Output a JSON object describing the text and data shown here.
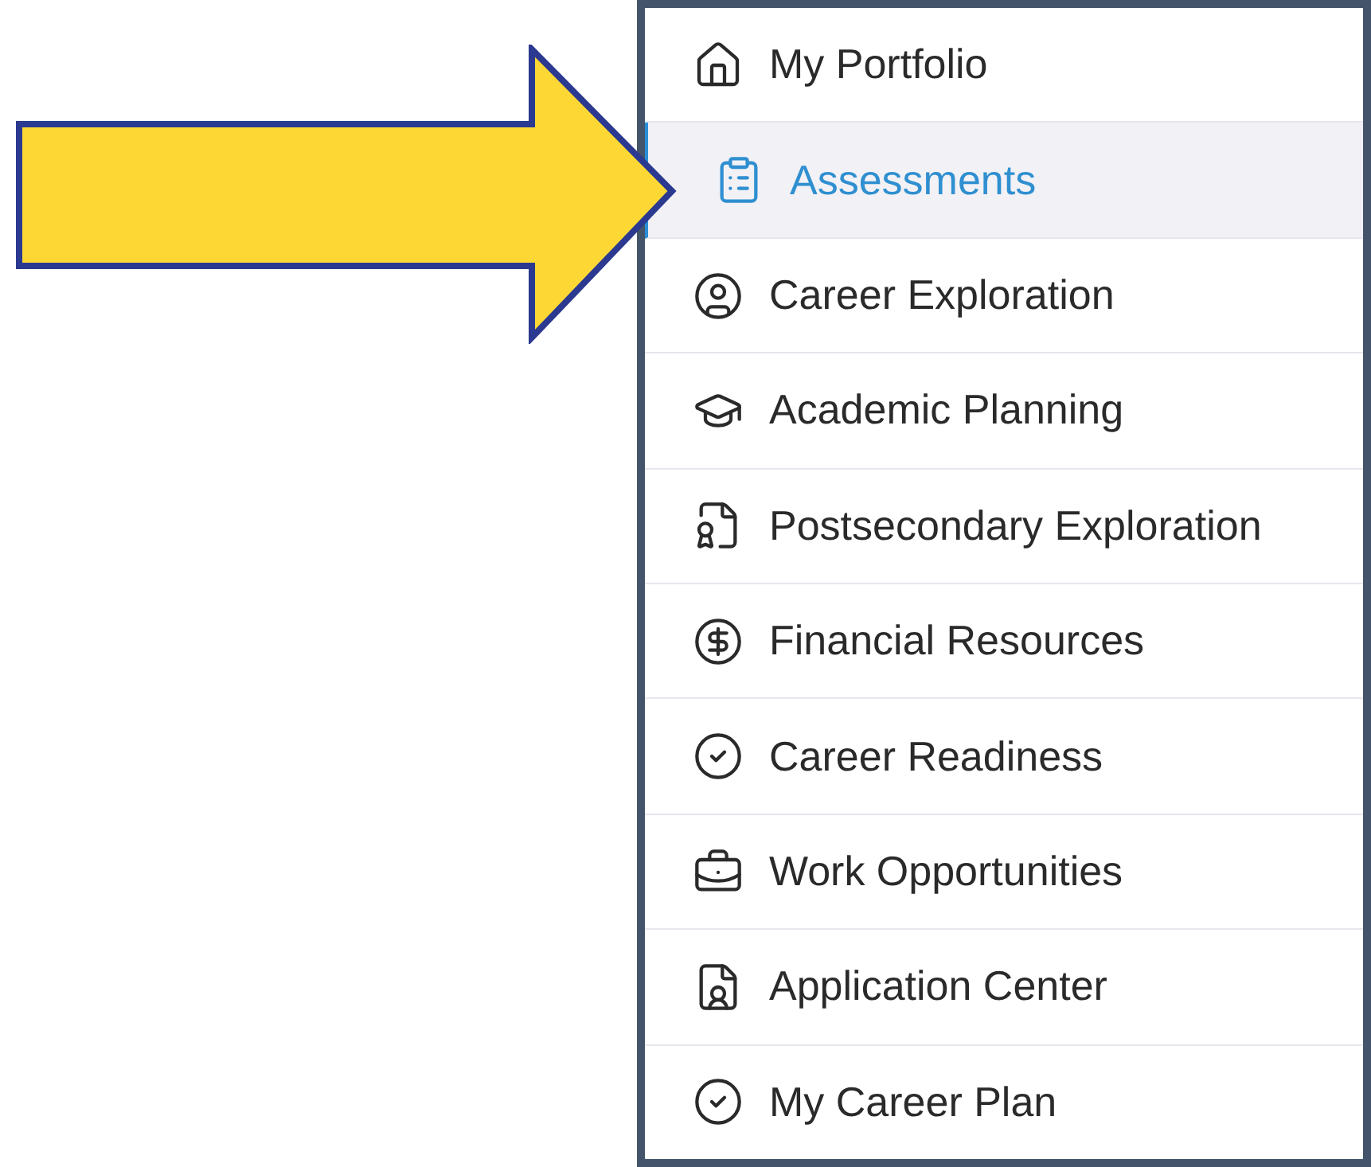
{
  "menu": {
    "items": [
      {
        "label": "My Portfolio",
        "selected": false
      },
      {
        "label": "Assessments",
        "selected": true
      },
      {
        "label": "Career Exploration",
        "selected": false
      },
      {
        "label": "Academic Planning",
        "selected": false
      },
      {
        "label": "Postsecondary Exploration",
        "selected": false
      },
      {
        "label": "Financial Resources",
        "selected": false
      },
      {
        "label": "Career Readiness",
        "selected": false
      },
      {
        "label": "Work Opportunities",
        "selected": false
      },
      {
        "label": "Application Center",
        "selected": false
      },
      {
        "label": "My Career Plan",
        "selected": false
      }
    ]
  }
}
